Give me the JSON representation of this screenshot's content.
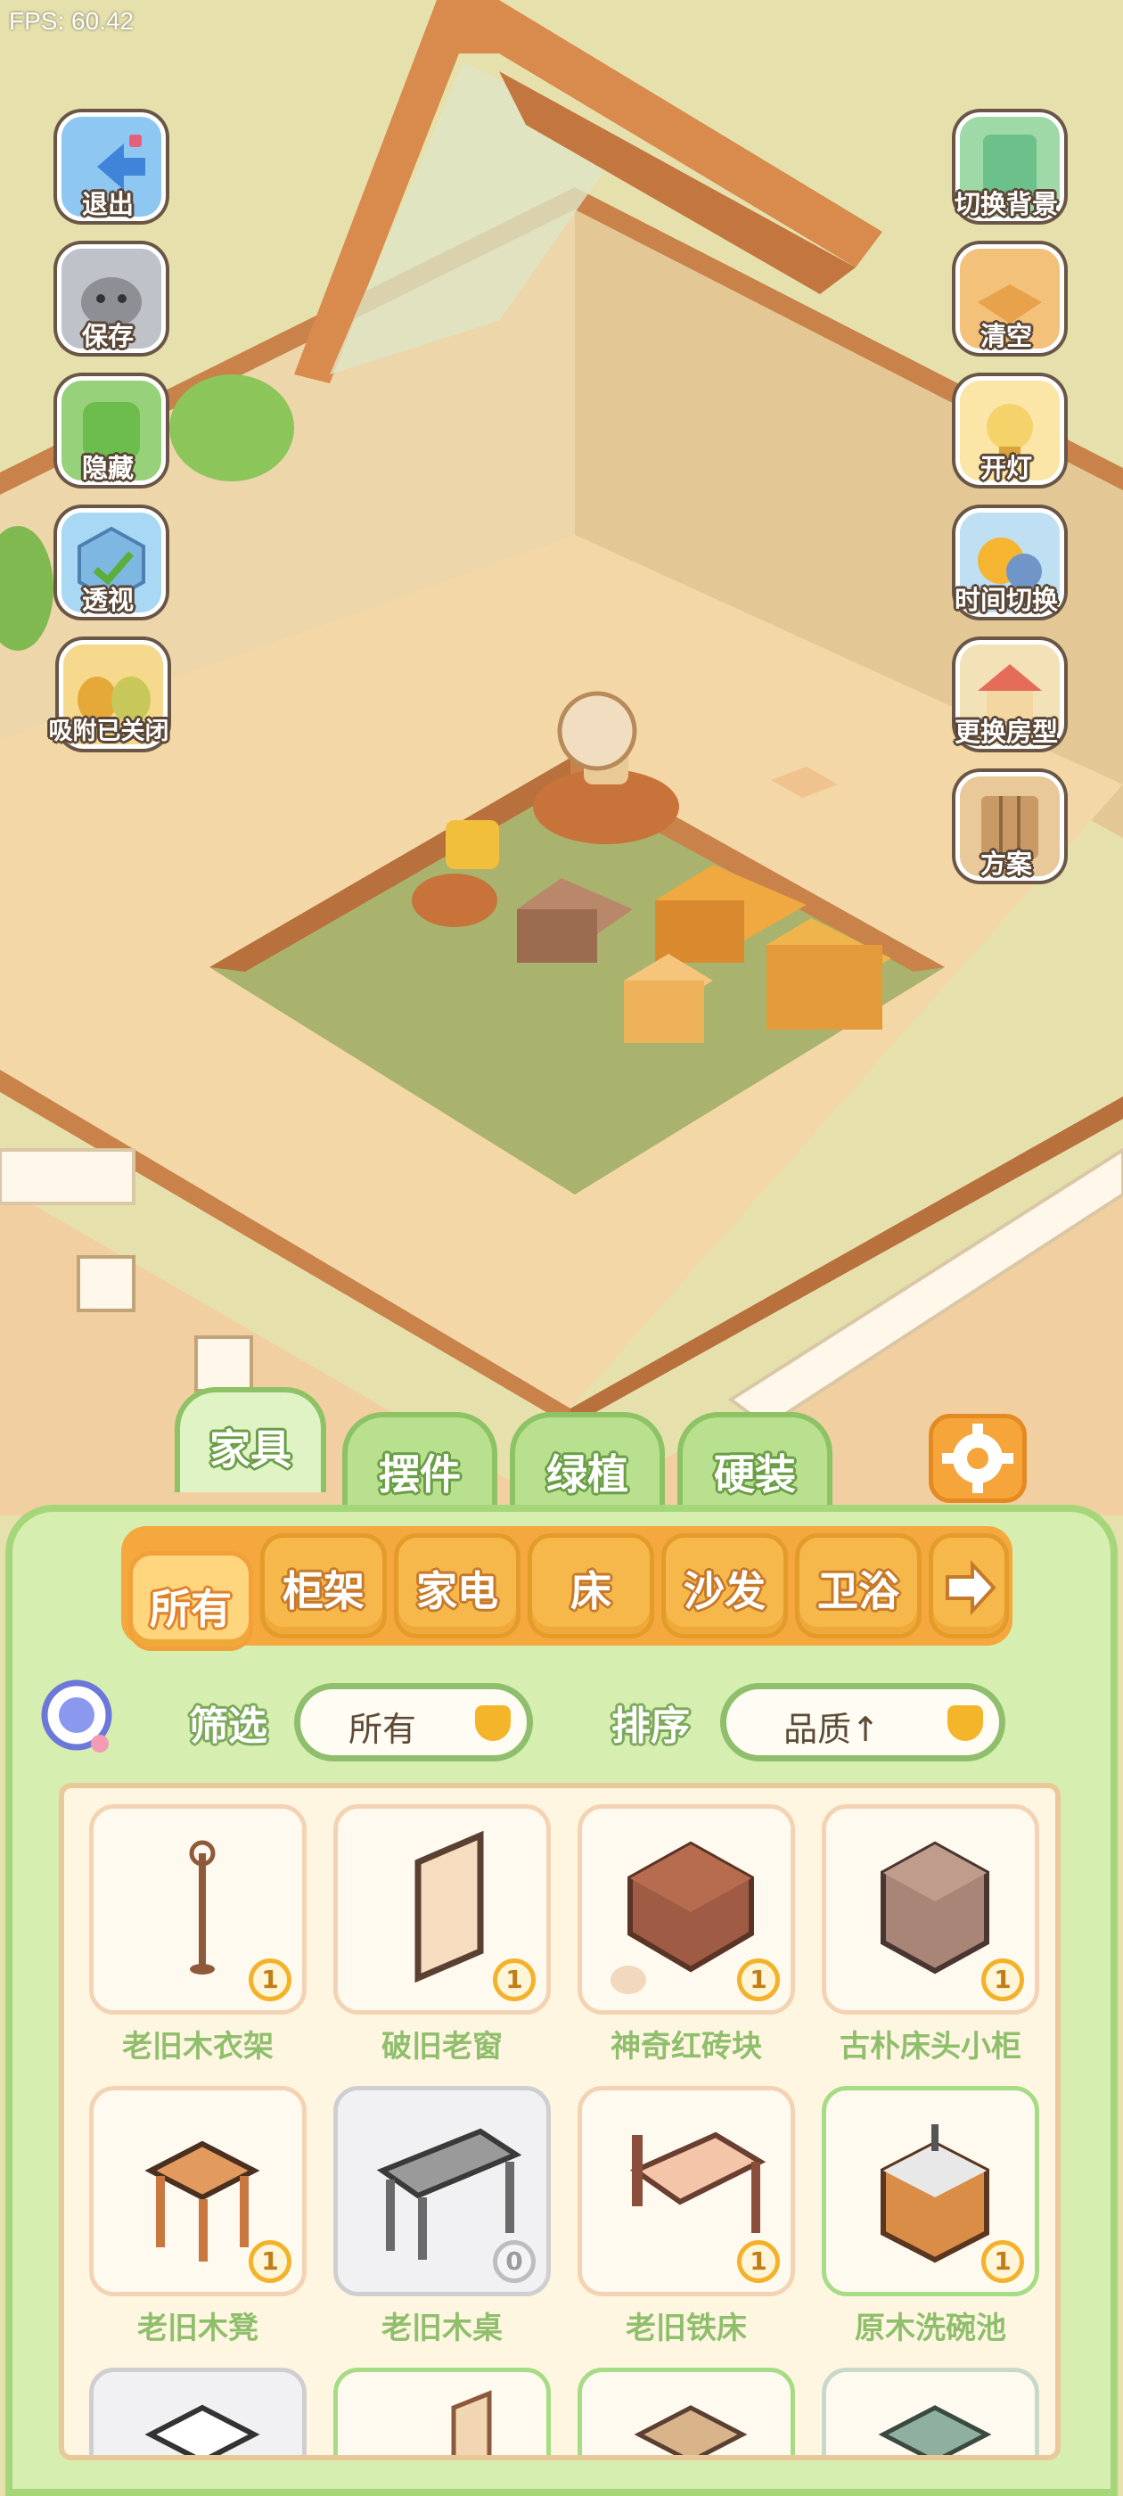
{
  "hud": {
    "fps": "FPS: 60.42"
  },
  "left_buttons": [
    {
      "label": "退出",
      "icon": "exit-icon"
    },
    {
      "label": "保存",
      "icon": "save-icon"
    },
    {
      "label": "隐藏",
      "icon": "hide-icon"
    },
    {
      "label": "透视",
      "icon": "perspective-icon"
    },
    {
      "label": "吸附已关闭",
      "icon": "snap-icon"
    }
  ],
  "right_buttons": [
    {
      "label": "切换背景",
      "icon": "background-icon"
    },
    {
      "label": "清空",
      "icon": "clear-icon"
    },
    {
      "label": "开灯",
      "icon": "light-icon"
    },
    {
      "label": "时间切换",
      "icon": "time-icon"
    },
    {
      "label": "更换房型",
      "icon": "house-icon"
    },
    {
      "label": "方案",
      "icon": "plan-icon"
    }
  ],
  "tabs": [
    {
      "label": "家具",
      "active": true
    },
    {
      "label": "摆件",
      "active": false
    },
    {
      "label": "绿植",
      "active": false
    },
    {
      "label": "硬装",
      "active": false
    }
  ],
  "categories": [
    {
      "label": "所有",
      "active": true
    },
    {
      "label": "柜架"
    },
    {
      "label": "家电"
    },
    {
      "label": "床"
    },
    {
      "label": "沙发"
    },
    {
      "label": "卫浴"
    }
  ],
  "filter": {
    "label": "筛选",
    "value": "所有"
  },
  "sort": {
    "label": "排序",
    "value": "品质↑"
  },
  "items": [
    {
      "name": "老旧木衣架",
      "count": "1"
    },
    {
      "name": "破旧老窗",
      "count": "1"
    },
    {
      "name": "神奇红砖块",
      "count": "1"
    },
    {
      "name": "古朴床头小柜",
      "count": "1"
    },
    {
      "name": "老旧木凳",
      "count": "1"
    },
    {
      "name": "老旧木桌",
      "count": "0"
    },
    {
      "name": "老旧铁床",
      "count": "1"
    },
    {
      "name": "原木洗碗池",
      "count": "1"
    }
  ],
  "colors": {
    "panel": "#d6efb0",
    "tab": "#b9e08f",
    "category": "#f6b84b",
    "floor": "#f3d7a6",
    "wall": "#e9d3a8"
  }
}
